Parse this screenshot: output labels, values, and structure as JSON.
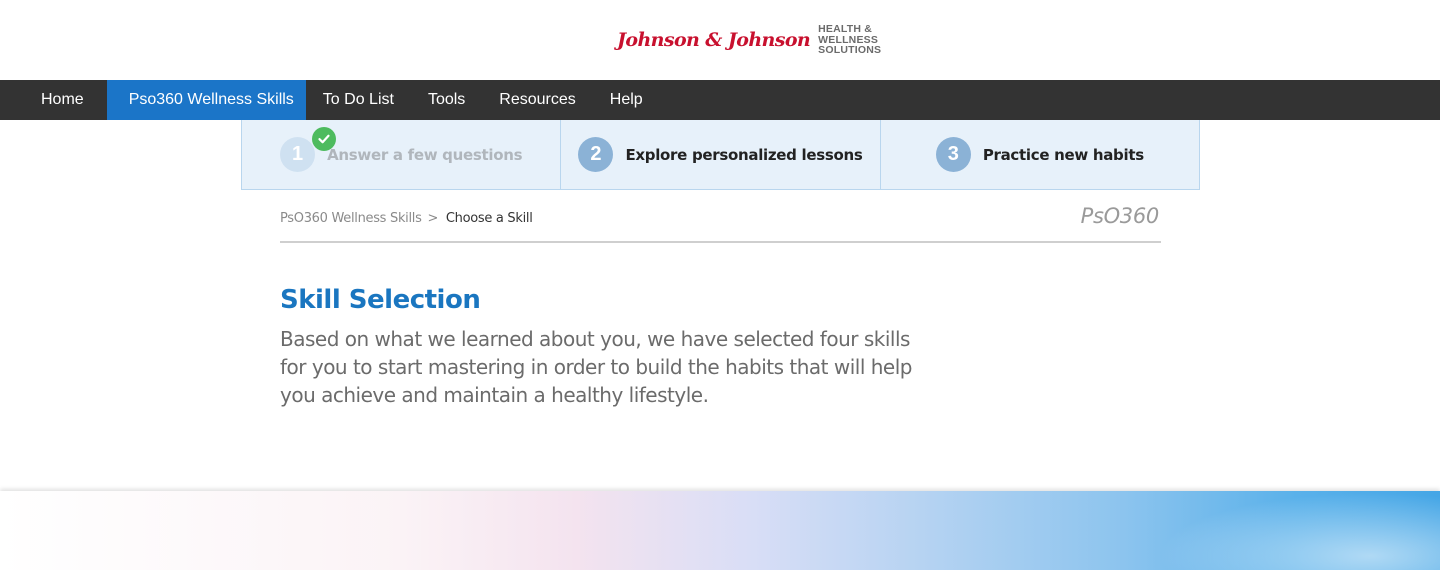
{
  "header": {
    "logo_script": "Johnson & Johnson",
    "logo_tagline": [
      "HEALTH &",
      "WELLNESS",
      "SOLUTIONS"
    ]
  },
  "nav": {
    "items": [
      {
        "label": "Home"
      },
      {
        "label": "Pso360 Wellness Skills",
        "active": true
      },
      {
        "label": "To Do List"
      },
      {
        "label": "Tools"
      },
      {
        "label": "Resources"
      },
      {
        "label": "Help"
      }
    ]
  },
  "steps": [
    {
      "number": "1",
      "label": "Answer a few questions",
      "completed": true
    },
    {
      "number": "2",
      "label": "Explore personalized lessons",
      "completed": false
    },
    {
      "number": "3",
      "label": "Practice new habits",
      "completed": false
    }
  ],
  "breadcrumb": {
    "parent": "PsO360 Wellness Skills",
    "separator": ">",
    "current": "Choose a Skill"
  },
  "brandmark": "PsO360",
  "section": {
    "title": "Skill Selection",
    "body": "Based on what we learned about you, we have selected four skills for you to start mastering in order to build the habits that will help you achieve and maintain a healthy lifestyle."
  },
  "colors": {
    "nav_bg": "#333333",
    "nav_active": "#1b75c8",
    "title_blue": "#1a76c0",
    "step_bg": "#e7f1fa",
    "check_green": "#4dbb5e",
    "logo_red": "#c8102e"
  }
}
